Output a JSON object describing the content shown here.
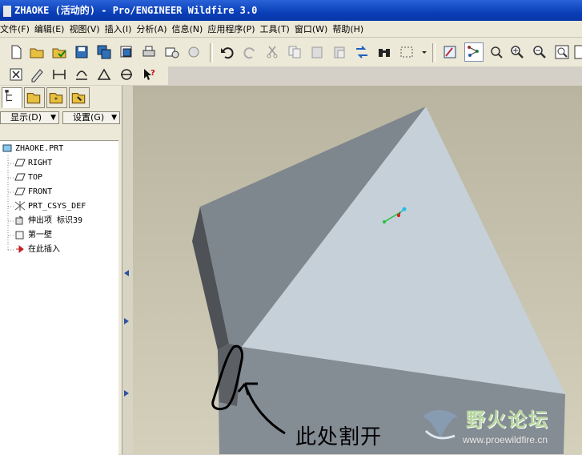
{
  "window": {
    "title": "ZHAOKE (活动的) - Pro/ENGINEER Wildfire 3.0"
  },
  "menu": [
    "文件(F)",
    "编辑(E)",
    "视图(V)",
    "插入(I)",
    "分析(A)",
    "信息(N)",
    "应用程序(P)",
    "工具(T)",
    "窗口(W)",
    "帮助(H)"
  ],
  "panel": {
    "show_label": "显示(D)",
    "settings_label": "设置(G)",
    "tree": [
      {
        "label": "ZHAOKE.PRT",
        "icon": "part-icon"
      },
      {
        "label": "RIGHT",
        "icon": "datum-plane-icon"
      },
      {
        "label": "TOP",
        "icon": "datum-plane-icon"
      },
      {
        "label": "FRONT",
        "icon": "datum-plane-icon"
      },
      {
        "label": "PRT_CSYS_DEF",
        "icon": "csys-icon"
      },
      {
        "label": "伸出项 标识39",
        "icon": "extrude-icon"
      },
      {
        "label": "第一壁",
        "icon": "shell-icon"
      },
      {
        "label": "在此插入",
        "icon": "insert-here-arrow-icon"
      }
    ]
  },
  "annotation": {
    "text": "此处割开"
  },
  "watermark": {
    "title": "野火论坛",
    "url": "www.proewildfire.cn"
  },
  "colors": {
    "titlebar": "#0a3fb8",
    "viewport_bg": "#c8c4ac",
    "model_top": "#c4ced8",
    "model_side": "#7c848c",
    "model_dark": "#4c5054"
  }
}
